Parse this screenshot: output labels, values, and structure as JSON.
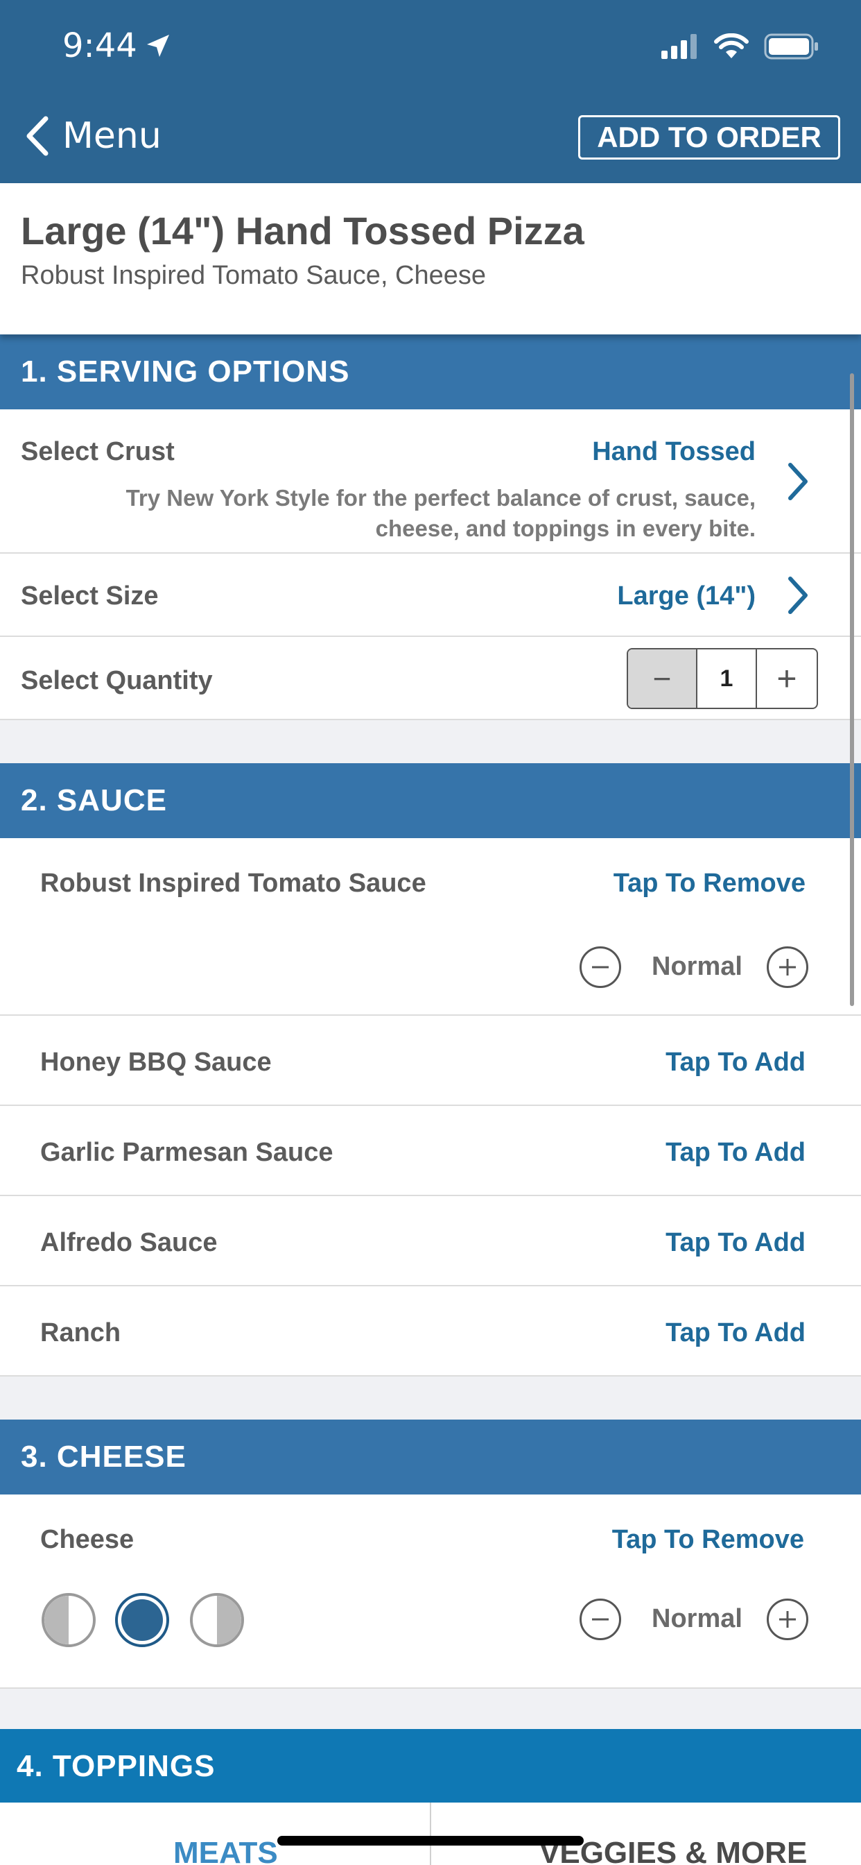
{
  "status_bar": {
    "time": "9:44"
  },
  "nav": {
    "back_label": "Menu",
    "add_to_order": "ADD TO ORDER"
  },
  "product": {
    "title": "Large (14\") Hand Tossed Pizza",
    "description": "Robust Inspired Tomato Sauce, Cheese"
  },
  "serving_options": {
    "header": "1. SERVING OPTIONS",
    "crust_label": "Select Crust",
    "crust_value": "Hand Tossed",
    "crust_hint": "Try New York Style for the perfect balance of crust, sauce, cheese, and toppings in every bite.",
    "size_label": "Select Size",
    "size_value": "Large (14\")",
    "quantity_label": "Select Quantity",
    "quantity_value": "1",
    "quantity_minus": "−",
    "quantity_plus": "+"
  },
  "sauce": {
    "header": "2. SAUCE",
    "selected": {
      "name": "Robust Inspired Tomato Sauce",
      "action": "Tap To Remove",
      "amount": "Normal"
    },
    "options": [
      {
        "name": "Honey BBQ Sauce",
        "action": "Tap To Add"
      },
      {
        "name": "Garlic Parmesan Sauce",
        "action": "Tap To Add"
      },
      {
        "name": "Alfredo Sauce",
        "action": "Tap To Add"
      },
      {
        "name": "Ranch",
        "action": "Tap To Add"
      }
    ]
  },
  "cheese": {
    "header": "3. CHEESE",
    "name": "Cheese",
    "action": "Tap To Remove",
    "amount": "Normal",
    "portion_selected": "whole"
  },
  "toppings": {
    "header": "4. TOPPINGS",
    "tabs": [
      "MEATS",
      "VEGGIES & MORE"
    ]
  },
  "colors": {
    "header_bg": "#2c6592",
    "section_bg": "#3674aa",
    "toppings_bg": "#0f78b4",
    "link": "#1f6a9a"
  }
}
